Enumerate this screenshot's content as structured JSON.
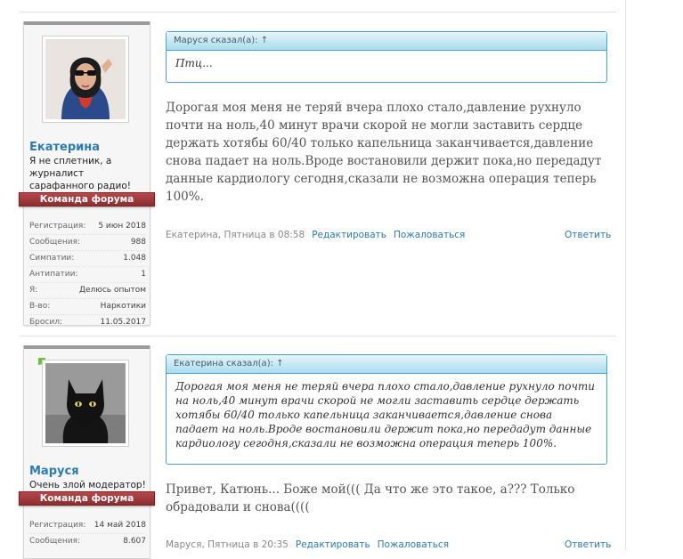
{
  "posts": [
    {
      "author": {
        "name": "Екатерина",
        "title": "Я не сплетник, а журналист сарафанного радио!",
        "banner": "Команда форума",
        "stats": [
          {
            "label": "Регистрация:",
            "value": "5 июн 2018"
          },
          {
            "label": "Сообщения:",
            "value": "988"
          },
          {
            "label": "Симпатии:",
            "value": "1.048"
          },
          {
            "label": "Антипатии:",
            "value": "1"
          },
          {
            "label": "Я:",
            "value": "Делюсь опытом"
          },
          {
            "label": "В-во:",
            "value": "Наркотики"
          },
          {
            "label": "Бросил:",
            "value": "11.05.2017"
          }
        ]
      },
      "quote": {
        "header": "Маруся сказал(а): ↑",
        "text": "Птц..."
      },
      "text": "Дорогая моя меня не теряй вчера плохо стало,давление рухнуло почти на ноль,40 минут врачи скорой не могли заставить сердце держать хотябы 60/40 только капельница заканчивается,давление снова падает на ноль.Вроде востановили держит пока,но передадут данные кардиологу сегодня,сказали не возможна операция теперь 100%.",
      "meta": "Екатерина, Пятница в 08:58",
      "edit_label": "Редактировать",
      "report_label": "Пожаловаться",
      "reply_label": "Ответить"
    },
    {
      "author": {
        "name": "Маруся",
        "title": "Очень злой модератор!",
        "banner": "Команда форума",
        "stats": [
          {
            "label": "Регистрация:",
            "value": "14 май 2018"
          },
          {
            "label": "Сообщения:",
            "value": "8.607"
          }
        ]
      },
      "quote": {
        "header": "Екатерина сказал(а): ↑",
        "text": "Дорогая моя меня не теряй вчера плохо стало,давление рухнуло почти на ноль,40 минут врачи скорой не могли заставить сердце держать хотябы 60/40 только капельница заканчивается,давление снова падает на ноль.Вроде востановили держит пока,но передадут данные кардиологу сегодня,сказали не возможна операция теперь 100%."
      },
      "text": "Привет, Катюнь... Боже мой((( Да что же это такое, а??? Только обрадовали и снова((((",
      "meta": "Маруся, Пятница в 20:35",
      "edit_label": "Редактировать",
      "report_label": "Пожаловаться",
      "reply_label": "Ответить"
    }
  ],
  "colors": {
    "link": "#2b7bb9",
    "banner": "#9e3a3c",
    "quote_border": "#4aa3cf",
    "online": "#6fc23b"
  }
}
